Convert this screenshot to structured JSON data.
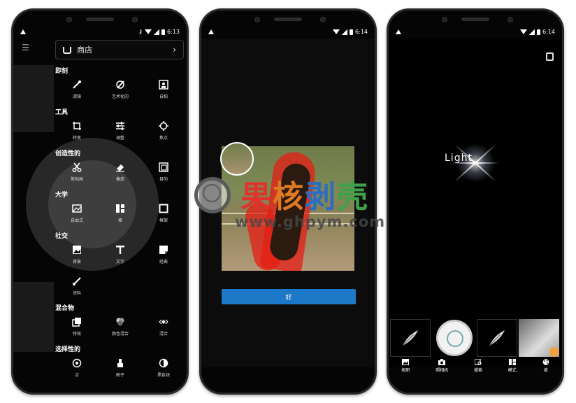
{
  "status": {
    "phone1_time": "6:13",
    "phone2_time": "6:14",
    "phone3_time": "6:14"
  },
  "phone1": {
    "store_label": "商店",
    "sections": [
      {
        "title": "即刻",
        "tools": [
          "滤镜",
          "艺术化的",
          "自拍"
        ]
      },
      {
        "title": "工具",
        "tools": [
          "转变",
          "调整",
          "焦点"
        ]
      },
      {
        "title": "创造性的",
        "tools": [
          "剪贴画",
          "橡皮",
          "目的"
        ]
      },
      {
        "title": "大学",
        "tools": [
          "自由式",
          "格",
          "框架"
        ]
      },
      {
        "title": "社交",
        "tools": [
          "背景",
          "文字",
          "经典"
        ]
      },
      {
        "title": "",
        "tools": [
          "涂料"
        ]
      },
      {
        "title": "混合物",
        "tools": [
          "特效",
          "颜色混合",
          "混合"
        ]
      },
      {
        "title": "选择性的",
        "tools": [
          "点",
          "刷子",
          "黑色块"
        ]
      }
    ]
  },
  "phone2": {
    "ok_label": "好"
  },
  "watermark": {
    "brand_chars": [
      "果",
      "核",
      "剥",
      "壳"
    ],
    "url": "www.ghpym.com"
  },
  "phone3": {
    "center_text": "Light",
    "nav": [
      "相册",
      "照相机",
      "搜索",
      "模式",
      "填"
    ]
  },
  "colors": {
    "accent_blue": "#1e78c8",
    "mask_red": "#e61e14"
  }
}
